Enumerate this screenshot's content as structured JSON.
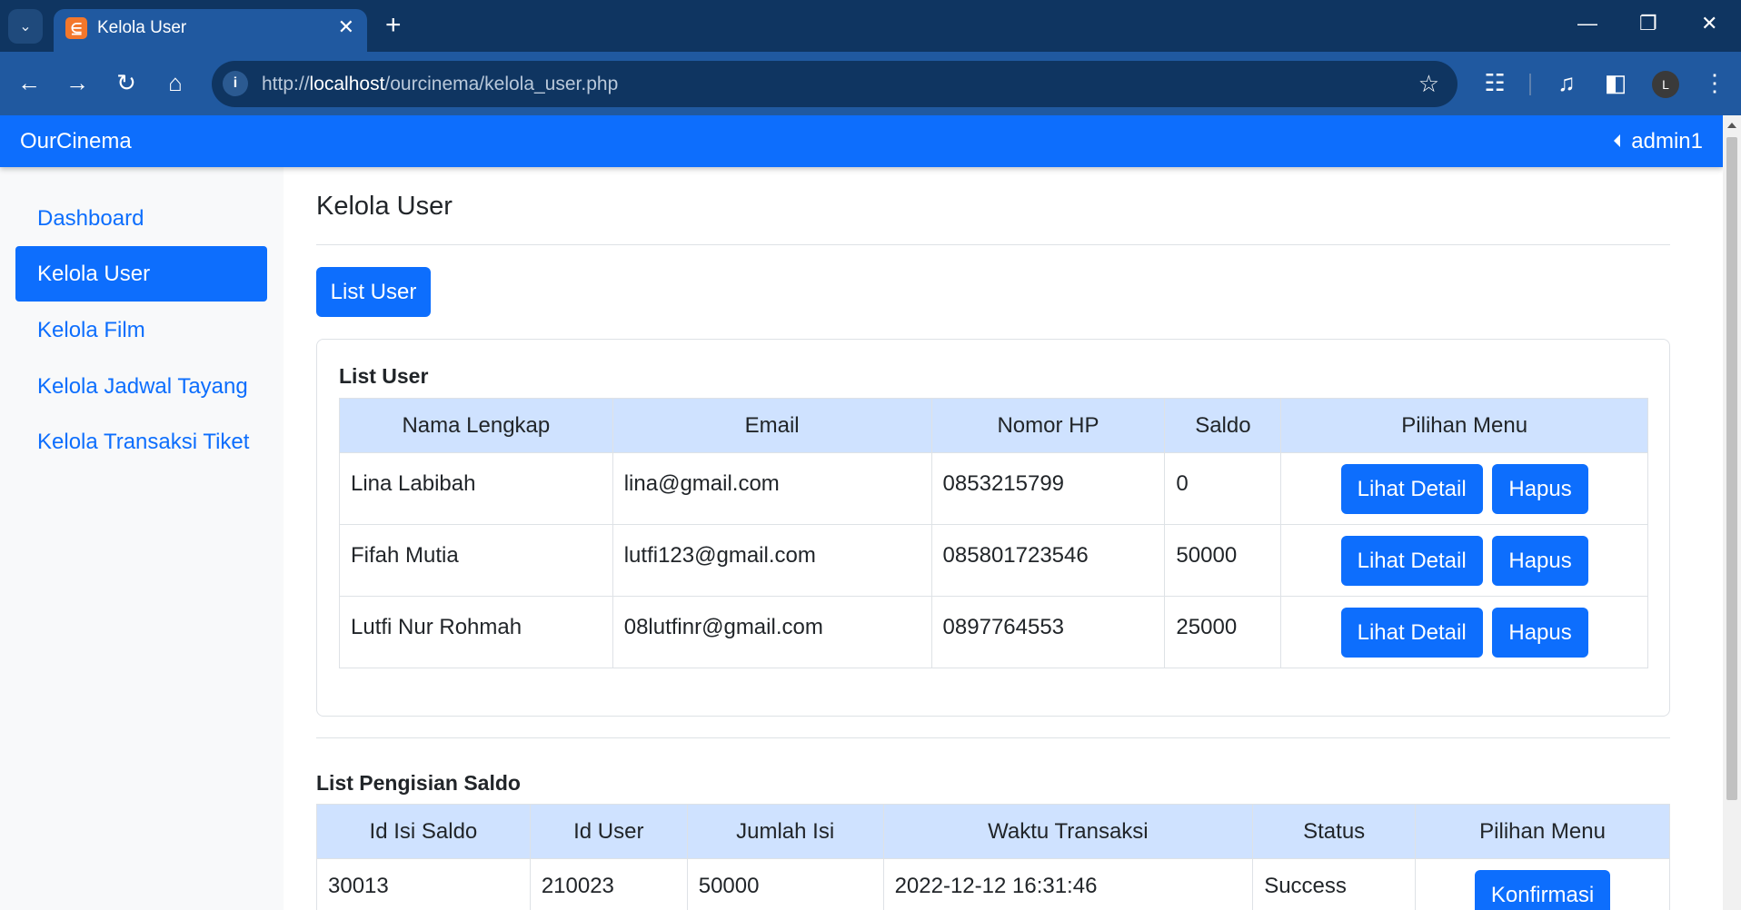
{
  "browser": {
    "tab_title": "Kelola User",
    "url_prefix": "http://",
    "url_host": "localhost",
    "url_path": "/ourcinema/kelola_user.php",
    "profile_initial": "L"
  },
  "navbar": {
    "brand": "OurCinema",
    "user": "admin1"
  },
  "sidebar": {
    "items": [
      {
        "label": "Dashboard"
      },
      {
        "label": "Kelola User"
      },
      {
        "label": "Kelola Film"
      },
      {
        "label": "Kelola Jadwal Tayang"
      },
      {
        "label": "Kelola Transaksi Tiket"
      }
    ]
  },
  "main": {
    "title": "Kelola User",
    "list_button": "List User",
    "user_card": {
      "title": "List User",
      "columns": [
        "Nama Lengkap",
        "Email",
        "Nomor HP",
        "Saldo",
        "Pilihan Menu"
      ],
      "rows": [
        {
          "name": "Lina Labibah",
          "email": "lina@gmail.com",
          "phone": "0853215799",
          "saldo": "0"
        },
        {
          "name": "Fifah Mutia",
          "email": "lutfi123@gmail.com",
          "phone": "085801723546",
          "saldo": "50000"
        },
        {
          "name": "Lutfi Nur Rohmah",
          "email": "08lutfinr@gmail.com",
          "phone": "0897764553",
          "saldo": "25000"
        }
      ],
      "detail_label": "Lihat Detail",
      "delete_label": "Hapus"
    },
    "saldo_section": {
      "title": "List Pengisian Saldo",
      "columns": [
        "Id Isi Saldo",
        "Id User",
        "Jumlah Isi",
        "Waktu Transaksi",
        "Status",
        "Pilihan Menu"
      ],
      "rows": [
        {
          "id": "30013",
          "user_id": "210023",
          "amount": "50000",
          "time": "2022-12-12 16:31:46",
          "status": "Success"
        }
      ],
      "confirm_label": "Konfirmasi"
    }
  },
  "colors": {
    "primary": "#0d6efd",
    "table_header": "#cfe2ff",
    "chrome_dark": "#0f3561",
    "chrome_light": "#2059a0"
  }
}
